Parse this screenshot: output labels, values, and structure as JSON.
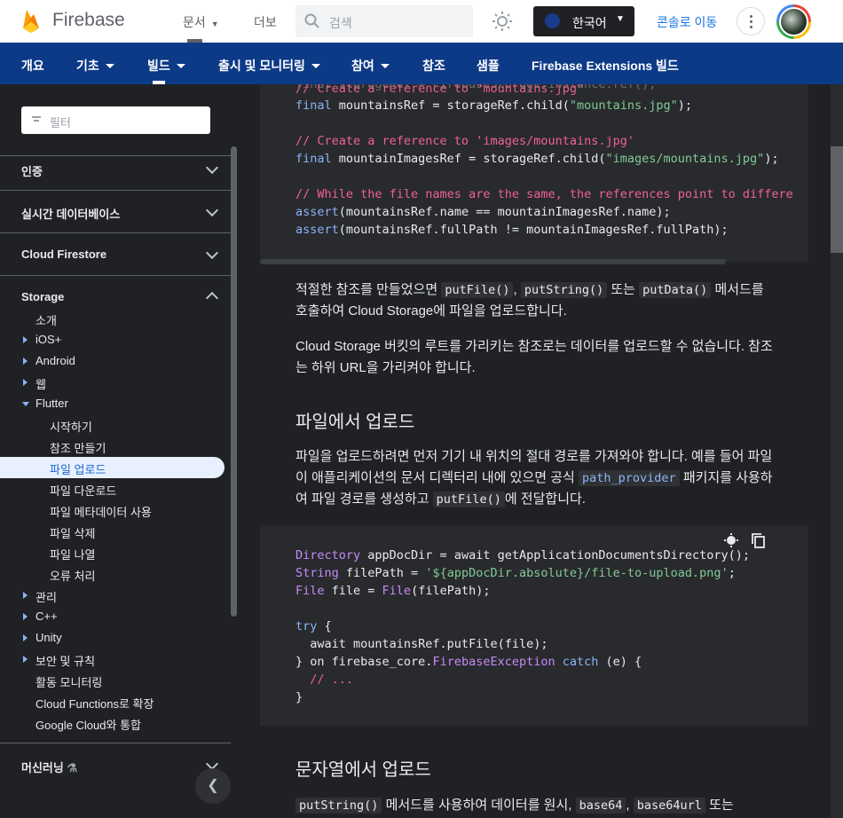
{
  "header": {
    "brand": "Firebase",
    "nav": [
      "문서",
      "더보"
    ],
    "search_placeholder": "검색",
    "language": "한국어",
    "console_link": "콘솔로 이동"
  },
  "subnav": [
    "개요",
    "기초",
    "빌드",
    "출시 및 모니터링",
    "참여",
    "참조",
    "샘플",
    "Firebase Extensions 빌드"
  ],
  "sidebar": {
    "filter_placeholder": "필터",
    "sections": [
      "인증",
      "실시간 데이터베이스",
      "Cloud Firestore",
      "Storage"
    ],
    "storage_items": [
      "소개",
      "iOS+",
      "Android",
      "웹",
      "Flutter"
    ],
    "flutter_items": [
      "시작하기",
      "참조 만들기",
      "파일 업로드",
      "파일 다운로드",
      "파일 메타데이터 사용",
      "파일 삭제",
      "파일 나열",
      "오류 처리"
    ],
    "more_items": [
      "관리",
      "C++",
      "Unity",
      "보안 및 규칙",
      "활동 모니터링",
      "Cloud Functions로 확장",
      "Google Cloud와 통합"
    ],
    "ml_section": "머신러닝"
  },
  "content": {
    "code1": {
      "c0": "final storageRef = FirebaseStorage.instance.ref();",
      "c1": "// Create a reference to \"mountains.jpg\"",
      "c2a": "final",
      "c2b": " mountainsRef = storageRef.child(",
      "c2c": "\"mountains.jpg\"",
      "c2d": ");",
      "c3": "// Create a reference to 'images/mountains.jpg'",
      "c4a": "final",
      "c4b": " mountainImagesRef = storageRef.child(",
      "c4c": "\"images/mountains.jpg\"",
      "c4d": ");",
      "c5": "// While the file names are the same, the references point to differe",
      "c6a": "assert",
      "c6b": "(mountainsRef.name == mountainImagesRef.name);",
      "c7a": "assert",
      "c7b": "(mountainsRef.fullPath != mountainImagesRef.fullPath);"
    },
    "p1": {
      "a": "적절한 참조를 만들었으면 ",
      "c1": "putFile()",
      "b": ", ",
      "c2": "putString()",
      "c": " 또는 ",
      "c3": "putData()",
      "d": " 메서드를 호출하여 Cloud Storage에 파일을 업로드합니다."
    },
    "p2": "Cloud Storage 버킷의 루트를 가리키는 참조로는 데이터를 업로드할 수 없습니다. 참조는 하위 URL을 가리켜야 합니다.",
    "h_file": "파일에서 업로드",
    "p3": {
      "a": "파일을 업로드하려면 먼저 기기 내 위치의 절대 경로를 가져와야 합니다. 예를 들어 파일이 애플리케이션의 문서 디렉터리 내에 있으면 공식 ",
      "link": "path_provider",
      "b": " 패키지를 사용하여 파일 경로를 생성하고 ",
      "c": "putFile()",
      "d": "에 전달합니다."
    },
    "code2": {
      "a1": "Directory",
      "a2": " appDocDir = await getApplicationDocumentsDirectory();",
      "b1": "String",
      "b2": " filePath = ",
      "b3": "'${appDocDir.absolute}/file-to-upload.png'",
      "b4": ";",
      "c1": "File",
      "c2": " file = ",
      "c3": "File",
      "c4": "(filePath);",
      "d1": "try",
      "d2": " {",
      "e": "  await mountainsRef.putFile(file);",
      "f1": "} on firebase_core.",
      "f2": "FirebaseException",
      "f3": " ",
      "f4": "catch",
      "f5": " (e) {",
      "g": "  // ...",
      "h": "}"
    },
    "h_string": "문자열에서 업로드",
    "p4": {
      "c1": "putString()",
      "a": " 메서드를 사용하여 데이터를 원시, ",
      "c2": "base64",
      "b": ", ",
      "c3": "base64url",
      "c": " 또는"
    }
  }
}
